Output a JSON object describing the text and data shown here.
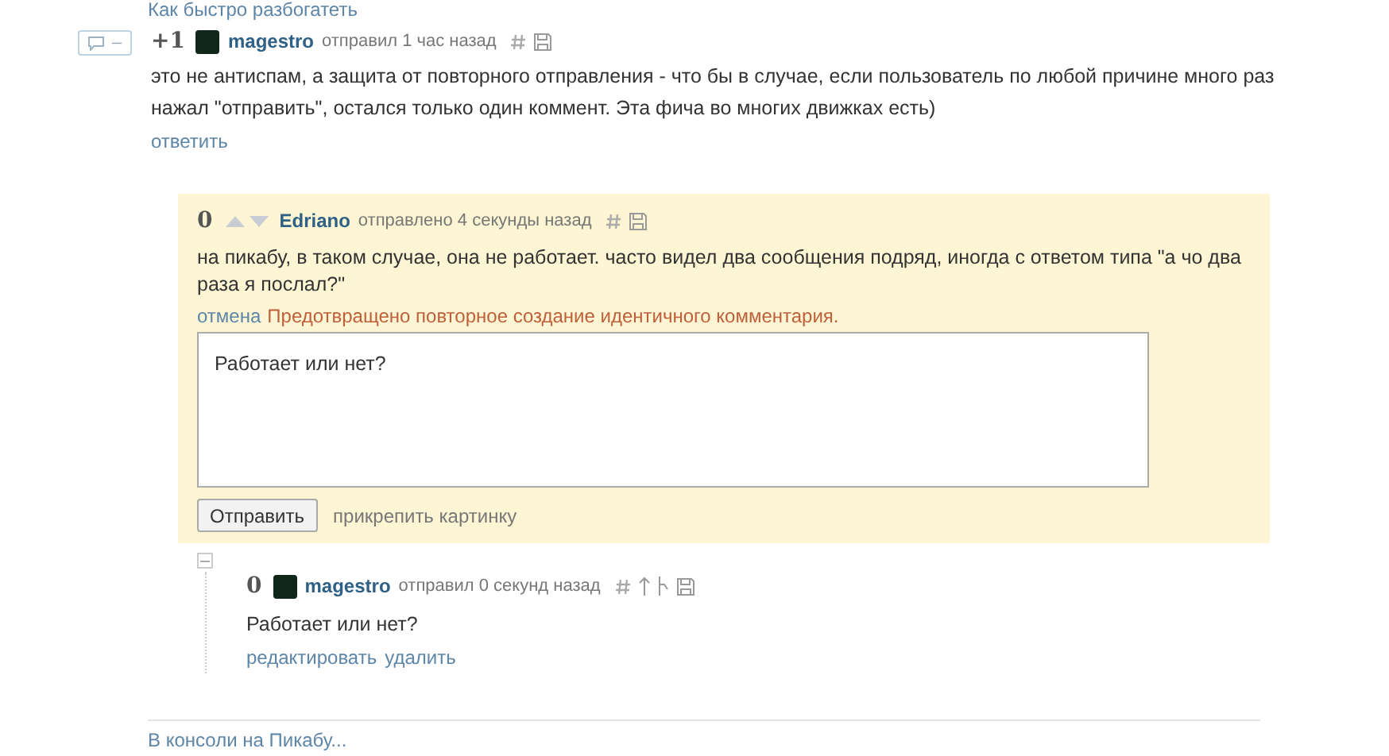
{
  "top_link": "Как быстро разбогатеть",
  "comment": {
    "collapse_label": "–",
    "score": "+1",
    "author": "magestro",
    "meta": "отправил 1 час назад",
    "text": "это не антиспам, а защита от повторного отправления - что бы в случае, если пользователь по любой причине много раз нажал \"отправить\", остался только один коммент. Эта фича во многих движках есть)",
    "actions": [
      "ответить"
    ]
  },
  "reply_form": {
    "parent": {
      "score": "0",
      "author": "Edriano",
      "meta": "отправлено 4 секунды назад",
      "text": "на пикабу, в таком случае, она не работает. часто видел два сообщения подряд, иногда с ответом типа \"а чо два раза я послал?\""
    },
    "cancel": "отмена",
    "error": "Предотвращено повторное создание идентичного комментария.",
    "value": "Работает или нет?",
    "submit": "Отправить",
    "attach": "прикрепить картинку"
  },
  "child": {
    "expanded": true,
    "score": "0",
    "author": "magestro",
    "meta": "отправил 0 секунд назад",
    "text": "Работает или нет?",
    "actions": [
      "редактировать",
      "удалить"
    ]
  },
  "footer_link": "В консоли на Пикабу..."
}
